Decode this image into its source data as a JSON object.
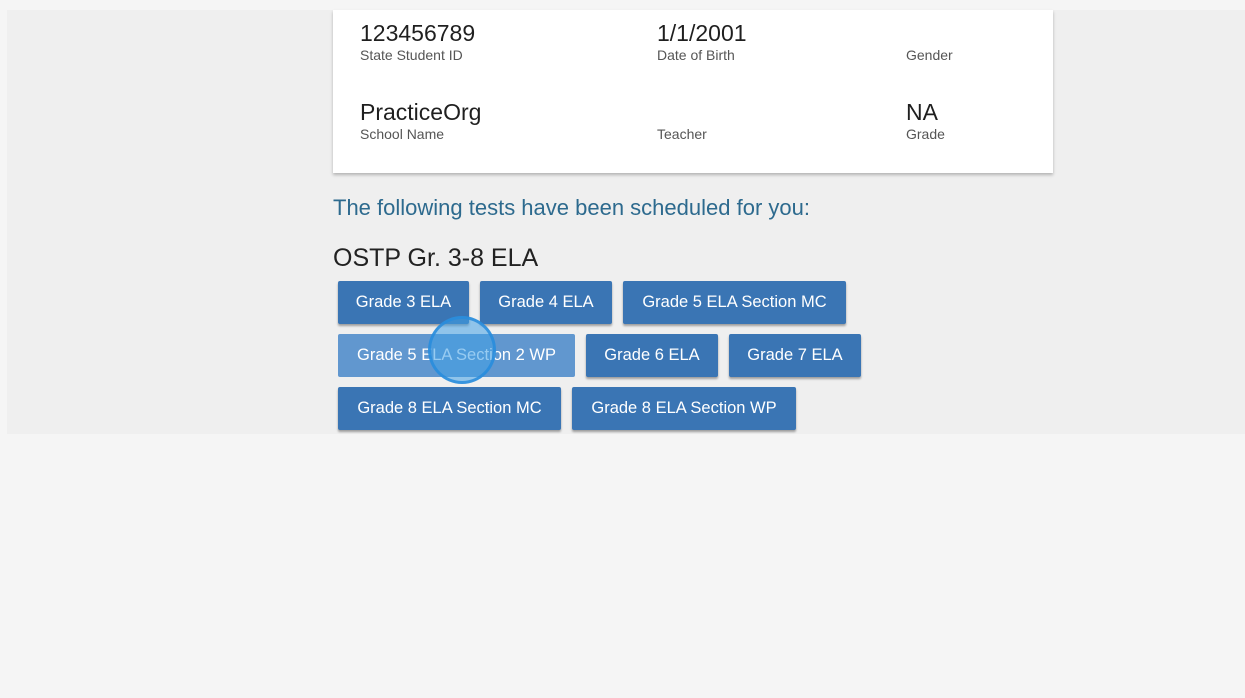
{
  "student": {
    "state_student_id": {
      "value": "123456789",
      "label": "State Student ID"
    },
    "date_of_birth": {
      "value": "1/1/2001",
      "label": "Date of Birth"
    },
    "gender": {
      "value": "",
      "label": "Gender"
    },
    "school_name": {
      "value": "PracticeOrg",
      "label": "School Name"
    },
    "teacher": {
      "value": "",
      "label": "Teacher"
    },
    "grade": {
      "value": "NA",
      "label": "Grade"
    }
  },
  "scheduled_heading": "The following tests have been scheduled for you:",
  "test_group": {
    "title": "OSTP Gr. 3-8 ELA",
    "tests": [
      {
        "label": "Grade 3 ELA"
      },
      {
        "label": "Grade 4 ELA"
      },
      {
        "label": "Grade 5 ELA Section MC"
      },
      {
        "label": "Grade 5 ELA Section 2 WP",
        "state": "hovered"
      },
      {
        "label": "Grade 6 ELA"
      },
      {
        "label": "Grade 7 ELA"
      },
      {
        "label": "Grade 8 ELA Section MC"
      },
      {
        "label": "Grade 8 ELA Section WP"
      }
    ]
  },
  "colors": {
    "button": "#3a75b4",
    "button_hover": "#6197cf",
    "heading_accent": "#2d6a8e",
    "click_indicator": "#42a0e6"
  }
}
